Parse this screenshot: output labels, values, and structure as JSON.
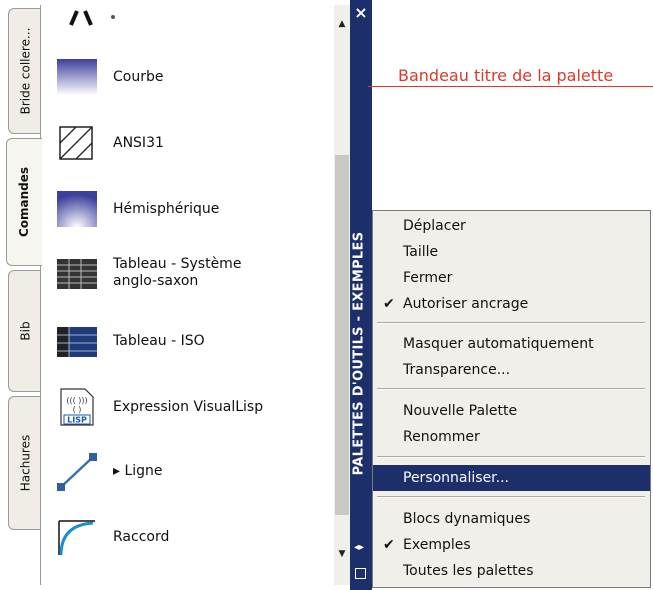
{
  "tabs": [
    {
      "label": "Bride collere..."
    },
    {
      "label": "Comandes"
    },
    {
      "label": "Bib"
    },
    {
      "label": "Hachures"
    }
  ],
  "palette_items": [
    {
      "label": "Courbe",
      "icon": "gradient-curve-icon"
    },
    {
      "label": "ANSI31",
      "icon": "hatch-pattern-icon"
    },
    {
      "label": "Hémisphérique",
      "icon": "gradient-hemisphere-icon"
    },
    {
      "label": "Tableau - Système anglo-saxon",
      "icon": "table-icon"
    },
    {
      "label": "Tableau - ISO",
      "icon": "table-iso-icon"
    },
    {
      "label": "Expression VisualLisp",
      "icon": "lisp-icon"
    },
    {
      "label": "▸ Ligne",
      "icon": "line-icon"
    },
    {
      "label": "Raccord",
      "icon": "fillet-icon"
    }
  ],
  "title_strip": {
    "title": "PALETTES D'OUTILS - EXEMPLES",
    "close": "×"
  },
  "annotation": {
    "text": "Bandeau titre de la palette"
  },
  "context_menu": {
    "items": [
      {
        "label": "Déplacer",
        "checked": false
      },
      {
        "label": "Taille",
        "checked": false
      },
      {
        "label": "Fermer",
        "checked": false
      },
      {
        "label": "Autoriser ancrage",
        "checked": true
      },
      {
        "label": "Masquer automatiquement",
        "checked": false
      },
      {
        "label": "Transparence...",
        "checked": false
      },
      {
        "label": "Nouvelle Palette",
        "checked": false
      },
      {
        "label": "Renommer",
        "checked": false
      },
      {
        "label": "Personnaliser...",
        "checked": false,
        "highlighted": true
      },
      {
        "label": "Blocs dynamiques",
        "checked": false
      },
      {
        "label": "Exemples",
        "checked": true
      },
      {
        "label": "Toutes les palettes",
        "checked": false
      }
    ],
    "check_glyph": "✔"
  },
  "colors": {
    "title_strip": "#1c2f6b",
    "annotation": "#d93a2a",
    "menu_bg": "#f0efe9"
  }
}
